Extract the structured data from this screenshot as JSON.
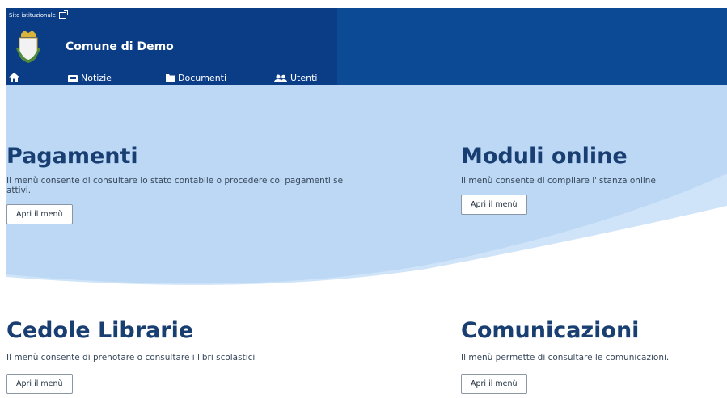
{
  "header": {
    "institutional_link": "Sito istituzionale",
    "brand_name": "Comune di Demo",
    "nav": [
      {
        "label": "",
        "icon": "home-icon"
      },
      {
        "label": "Notizie",
        "icon": "newspaper-icon"
      },
      {
        "label": "Documenti",
        "icon": "folder-icon"
      },
      {
        "label": "Utenti",
        "icon": "users-icon"
      }
    ]
  },
  "cards": [
    {
      "title": "Pagamenti",
      "description": "Il menù consente di consultare lo stato contabile o procedere coi pagamenti se attivi.",
      "button": "Apri il menù"
    },
    {
      "title": "Moduli online",
      "description": "Il menù consente di compilare l'istanza online",
      "button": "Apri il menù"
    },
    {
      "title": "Cedole Librarie",
      "description": "Il menù consente di prenotare o consultare i libri scolastici",
      "button": "Apri il menù"
    },
    {
      "title": "Comunicazioni",
      "description": "Il menù permette di consultare le comunicazioni.",
      "button": "Apri il menù"
    }
  ],
  "colors": {
    "header_dark": "#0b3d87",
    "header": "#0d4a95",
    "hero": "#bcd8f4",
    "title": "#193e72"
  }
}
